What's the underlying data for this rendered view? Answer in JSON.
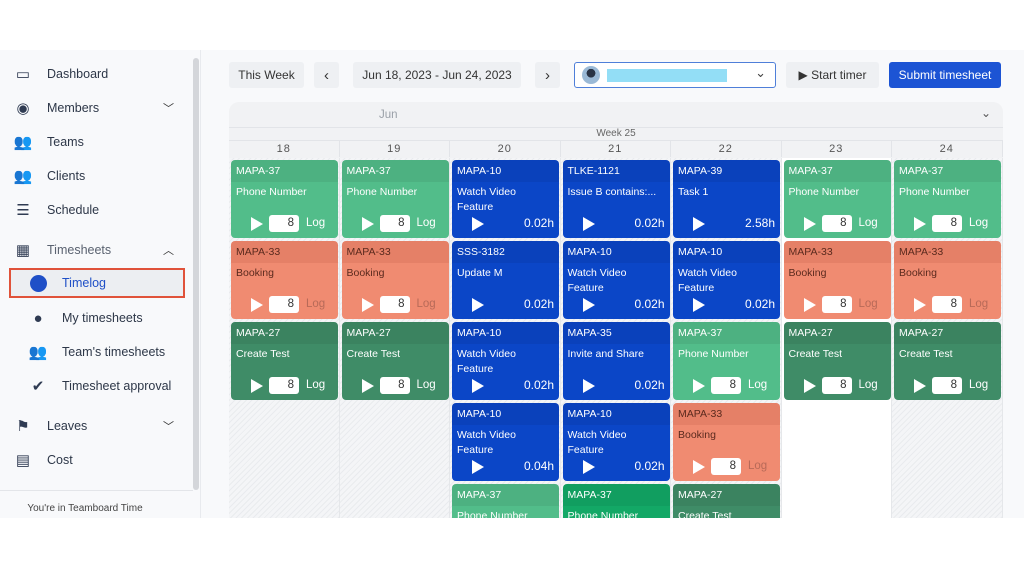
{
  "sidebar": {
    "items": [
      {
        "label": "Dashboard",
        "icon": "dashboard-icon"
      },
      {
        "label": "Members",
        "icon": "member-icon",
        "chevron": "down"
      },
      {
        "label": "Teams",
        "icon": "teams-icon"
      },
      {
        "label": "Clients",
        "icon": "clients-icon"
      },
      {
        "label": "Schedule",
        "icon": "schedule-icon"
      },
      {
        "label": "Timesheets",
        "icon": "grid-icon",
        "chevron": "up"
      },
      {
        "label": "Timelog",
        "icon": "clock-icon",
        "active": true
      },
      {
        "label": "My timesheets",
        "icon": "person-icon"
      },
      {
        "label": "Team's timesheets",
        "icon": "team-icon"
      },
      {
        "label": "Timesheet approval",
        "icon": "approval-icon"
      },
      {
        "label": "Leaves",
        "icon": "flag-icon",
        "chevron": "down"
      },
      {
        "label": "Cost",
        "icon": "calculator-icon"
      }
    ],
    "footer": "You're in Teamboard Time"
  },
  "toolbar": {
    "this_week": "This Week",
    "prev": "‹",
    "range": "Jun 18, 2023 - Jun 24, 2023",
    "next": "›",
    "user_chevron": "⌄",
    "start_timer": "▶ Start timer",
    "submit": "Submit timesheet"
  },
  "calendar": {
    "month": "Jun",
    "week": "Week 25",
    "collapse": "⌄",
    "days": [
      {
        "day": "18",
        "cards": [
          {
            "id": "MAPA-37",
            "title": "Phone Number",
            "kind": "green",
            "input": "8",
            "log": "Log"
          },
          {
            "id": "MAPA-33",
            "title": "Booking",
            "kind": "salmon",
            "input": "8",
            "log": "Log"
          },
          {
            "id": "MAPA-27",
            "title": "Create Test",
            "kind": "dgreen",
            "input": "8",
            "log": "Log"
          }
        ]
      },
      {
        "day": "19",
        "cards": [
          {
            "id": "MAPA-37",
            "title": "Phone Number",
            "kind": "green",
            "input": "8",
            "log": "Log"
          },
          {
            "id": "MAPA-33",
            "title": "Booking",
            "kind": "salmon",
            "input": "8",
            "log": "Log"
          },
          {
            "id": "MAPA-27",
            "title": "Create Test",
            "kind": "dgreen",
            "input": "8",
            "log": "Log"
          }
        ]
      },
      {
        "day": "20",
        "cards": [
          {
            "id": "MAPA-10",
            "title": "Watch Video Feature",
            "kind": "blue",
            "hours": "0.02h"
          },
          {
            "id": "SSS-3182",
            "title": "Update M",
            "kind": "blue",
            "hours": "0.02h"
          },
          {
            "id": "MAPA-10",
            "title": "Watch Video Feature",
            "kind": "blue",
            "hours": "0.02h"
          },
          {
            "id": "MAPA-10",
            "title": "Watch Video Feature",
            "kind": "blue",
            "hours": "0.04h"
          },
          {
            "id": "MAPA-37",
            "title": "Phone Number",
            "kind": "green"
          }
        ]
      },
      {
        "day": "21",
        "cards": [
          {
            "id": "TLKE-1121",
            "title": "Issue B contains:...",
            "kind": "blue",
            "hours": "0.02h"
          },
          {
            "id": "MAPA-10",
            "title": "Watch Video Feature",
            "kind": "blue",
            "hours": "0.02h"
          },
          {
            "id": "MAPA-35",
            "title": "Invite and Share",
            "kind": "blue",
            "hours": "0.02h"
          },
          {
            "id": "MAPA-10",
            "title": "Watch Video Feature",
            "kind": "blue",
            "hours": "0.02h"
          },
          {
            "id": "MAPA-37",
            "title": "Phone Number",
            "kind": "bgreen"
          }
        ]
      },
      {
        "day": "22",
        "cards": [
          {
            "id": "MAPA-39",
            "title": "Task 1",
            "kind": "blue",
            "hours": "2.58h"
          },
          {
            "id": "MAPA-10",
            "title": "Watch Video Feature",
            "kind": "blue",
            "hours": "0.02h"
          },
          {
            "id": "MAPA-37",
            "title": "Phone Number",
            "kind": "green",
            "input": "8",
            "log": "Log"
          },
          {
            "id": "MAPA-33",
            "title": "Booking",
            "kind": "salmon",
            "input": "8",
            "log": "Log"
          },
          {
            "id": "MAPA-27",
            "title": "Create Test",
            "kind": "dgreen"
          }
        ]
      },
      {
        "day": "23",
        "cards": [
          {
            "id": "MAPA-37",
            "title": "Phone Number",
            "kind": "green",
            "input": "8",
            "log": "Log"
          },
          {
            "id": "MAPA-33",
            "title": "Booking",
            "kind": "salmon",
            "input": "8",
            "log": "Log"
          },
          {
            "id": "MAPA-27",
            "title": "Create Test",
            "kind": "dgreen",
            "input": "8",
            "log": "Log"
          }
        ]
      },
      {
        "day": "24",
        "cards": [
          {
            "id": "MAPA-37",
            "title": "Phone Number",
            "kind": "green",
            "input": "8",
            "log": "Log"
          },
          {
            "id": "MAPA-33",
            "title": "Booking",
            "kind": "salmon",
            "input": "8",
            "log": "Log"
          },
          {
            "id": "MAPA-27",
            "title": "Create Test",
            "kind": "dgreen",
            "input": "8",
            "log": "Log"
          }
        ]
      }
    ]
  },
  "colors": {
    "accent": "#1c54d4",
    "active_outline": "#e0523a",
    "green": "#52bd8a",
    "salmon": "#f08b71",
    "dark_green": "#3f8c67",
    "blue": "#0b46c7"
  }
}
